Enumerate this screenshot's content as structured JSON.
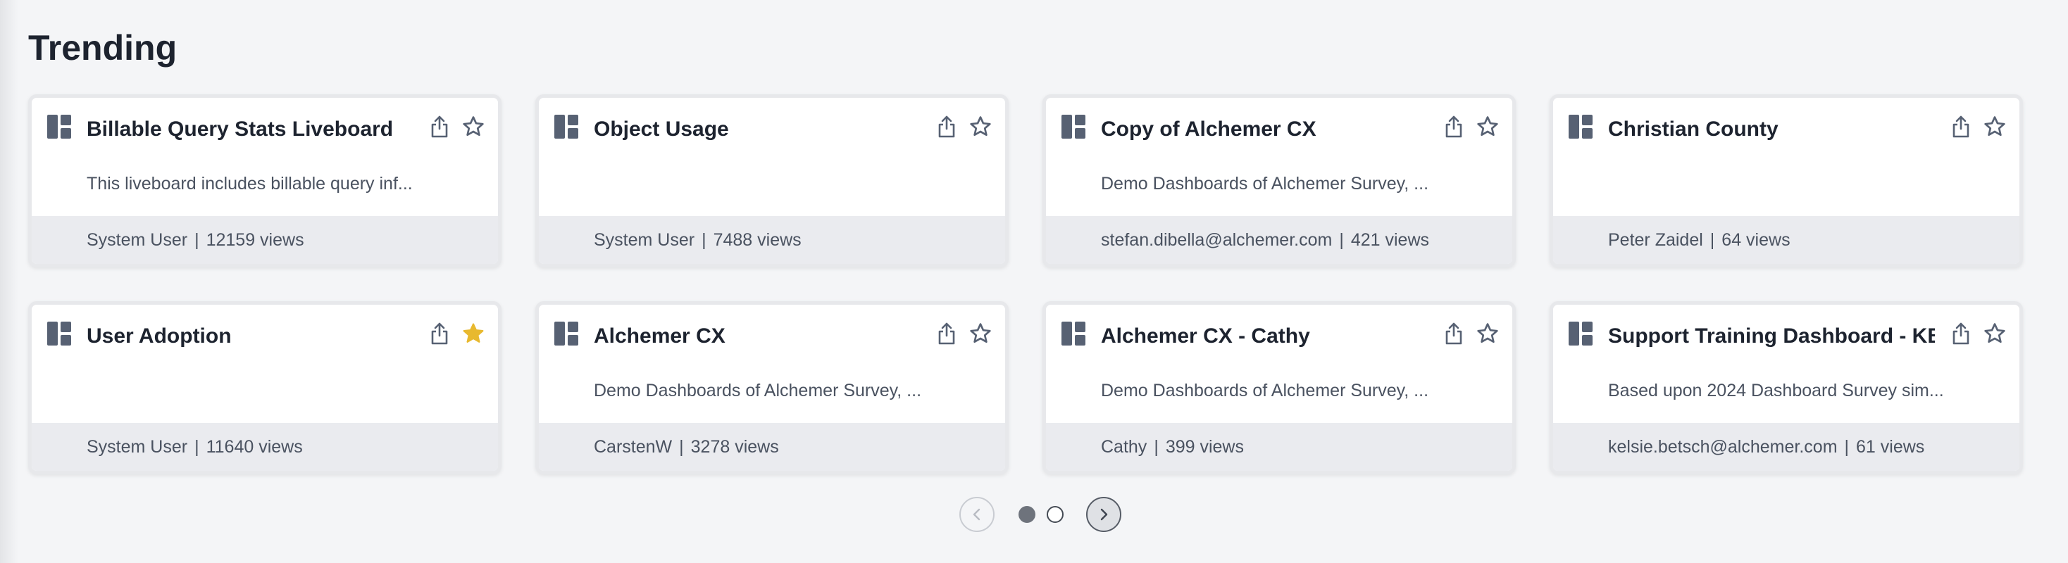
{
  "section": {
    "title": "Trending"
  },
  "colors": {
    "accent_star": "#e8b92f",
    "icon_gray": "#576173",
    "footer_bg": "#eaebef"
  },
  "icons": {
    "card": "liveboard-icon",
    "share": "share-icon",
    "favorite": "star-icon"
  },
  "cards": [
    {
      "title": "Billable Query Stats Liveboard",
      "description": "This liveboard includes billable query inf...",
      "author": "System User",
      "views": "12159 views",
      "favorited": false
    },
    {
      "title": "Object Usage",
      "description": "",
      "author": "System User",
      "views": "7488 views",
      "favorited": false
    },
    {
      "title": "Copy of Alchemer CX",
      "description": "Demo Dashboards of Alchemer Survey, ...",
      "author": "stefan.dibella@alchemer.com",
      "views": "421 views",
      "favorited": false
    },
    {
      "title": "Christian County",
      "description": "",
      "author": "Peter Zaidel",
      "views": "64 views",
      "favorited": false
    },
    {
      "title": "User Adoption",
      "description": "",
      "author": "System User",
      "views": "11640 views",
      "favorited": true
    },
    {
      "title": "Alchemer CX",
      "description": "Demo Dashboards of Alchemer Survey, ...",
      "author": "CarstenW",
      "views": "3278 views",
      "favorited": false
    },
    {
      "title": "Alchemer CX - Cathy",
      "description": "Demo Dashboards of Alchemer Survey, ...",
      "author": "Cathy",
      "views": "399 views",
      "favorited": false
    },
    {
      "title": "Support Training Dashboard - KB",
      "description": "Based upon 2024 Dashboard Survey sim...",
      "author": "kelsie.betsch@alchemer.com",
      "views": "61 views",
      "favorited": false
    }
  ],
  "pager": {
    "pages": 2,
    "current_page": 1,
    "prev_disabled": true
  }
}
